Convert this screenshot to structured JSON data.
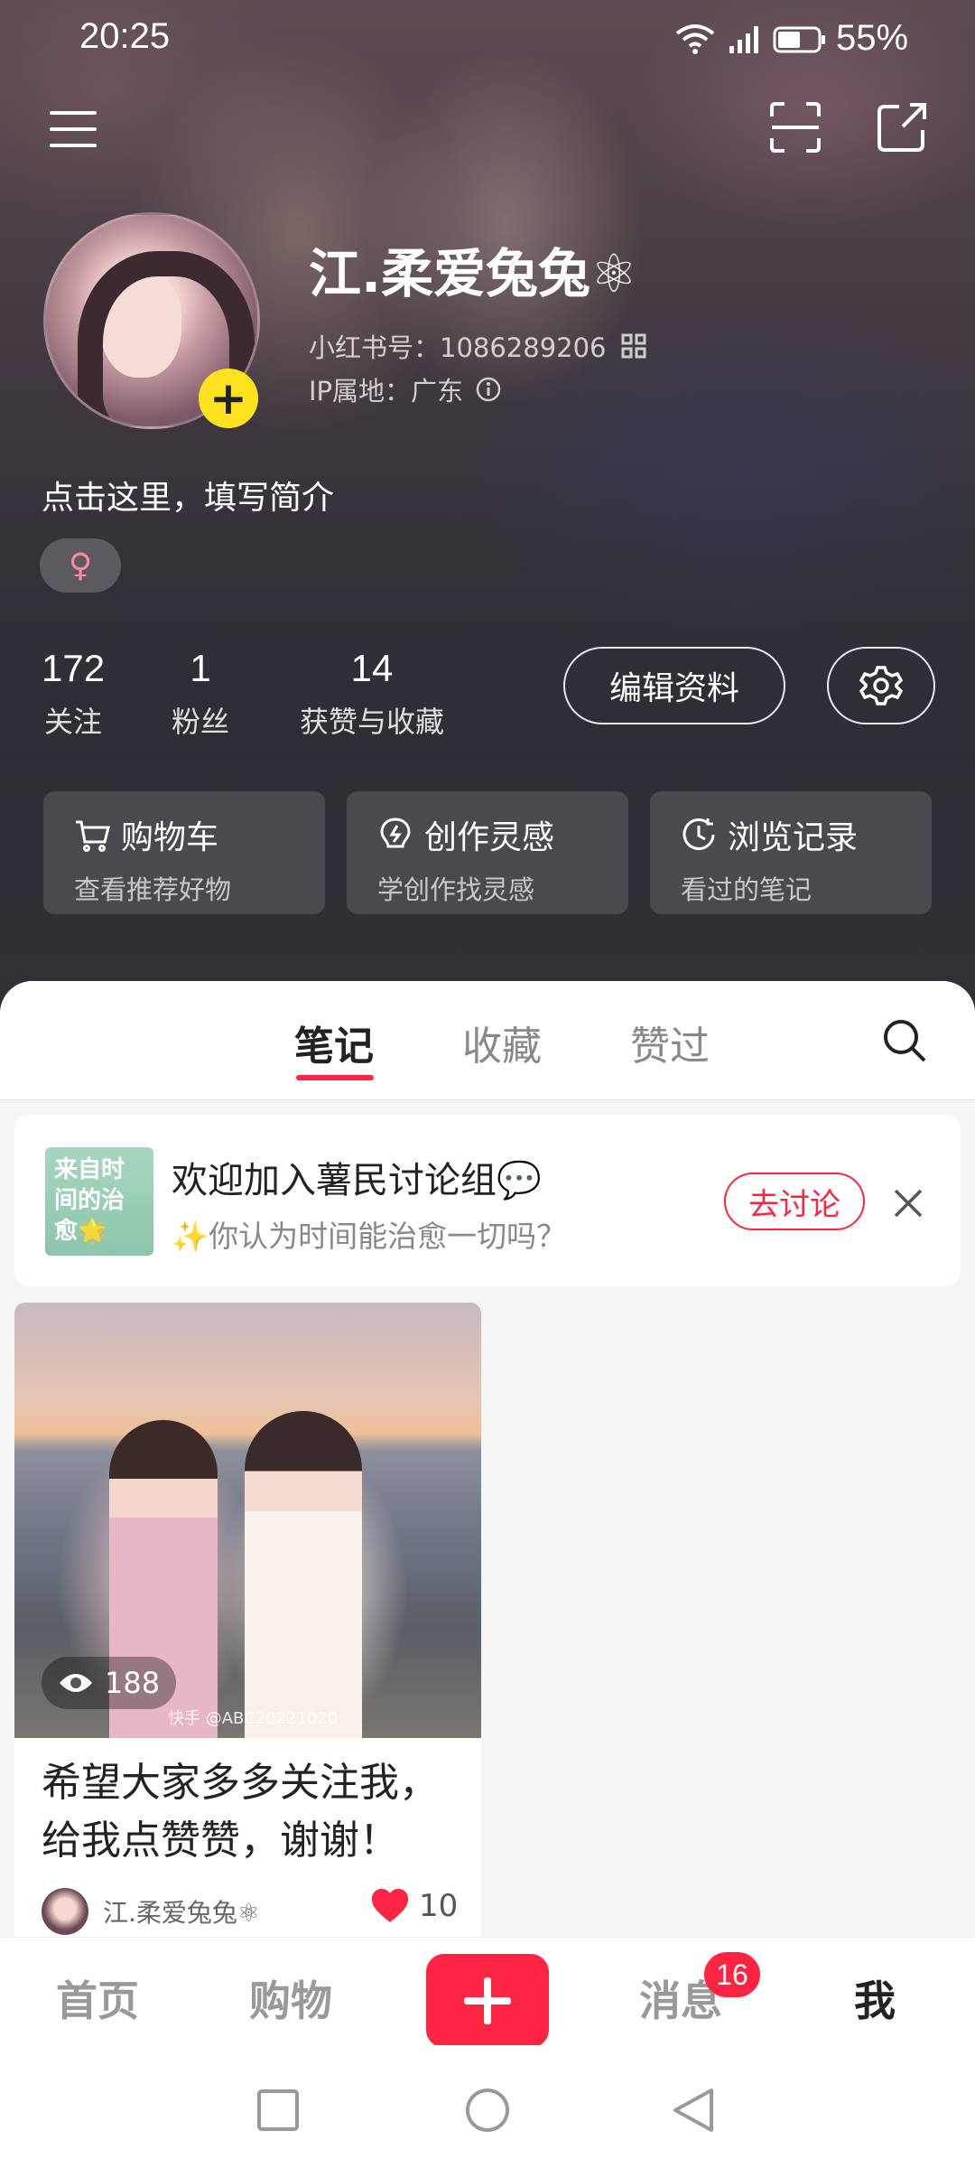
{
  "status_bar": {
    "time": "20:25",
    "battery": "55%",
    "network": "4G"
  },
  "profile": {
    "name": "江.柔爱兔兔⚛",
    "id_label": "小红书号：1086289206",
    "ip_label": "IP属地：广东",
    "bio_placeholder": "点击这里，填写简介",
    "gender_symbol": "♀",
    "stats": [
      {
        "value": "172",
        "label": "关注"
      },
      {
        "value": "1",
        "label": "粉丝"
      },
      {
        "value": "14",
        "label": "获赞与收藏"
      }
    ],
    "edit_button": "编辑资料"
  },
  "quick_links": [
    {
      "title": "购物车",
      "subtitle": "查看推荐好物",
      "icon": "cart-icon"
    },
    {
      "title": "创作灵感",
      "subtitle": "学创作找灵感",
      "icon": "bulb-icon"
    },
    {
      "title": "浏览记录",
      "subtitle": "看过的笔记",
      "icon": "clock-icon"
    }
  ],
  "tabs": [
    {
      "label": "笔记",
      "active": true
    },
    {
      "label": "收藏",
      "active": false
    },
    {
      "label": "赞过",
      "active": false
    }
  ],
  "banner": {
    "thumb_text": "来自时间的治愈🌟",
    "title": "欢迎加入薯民讨论组💬",
    "subtitle": "✨你认为时间能治愈一切吗？",
    "action": "去讨论"
  },
  "note_card": {
    "views": "188",
    "watermark": "快手 @ABC20221020",
    "title": "希望大家多多关注我，给我点赞赞，谢谢！",
    "author": "江.柔爱兔兔⚛",
    "likes": "10"
  },
  "bottom_nav": {
    "items": [
      "首页",
      "购物",
      "消息",
      "我"
    ],
    "message_badge": "16",
    "active": "我"
  },
  "colors": {
    "accent": "#ff2442",
    "badge_yellow": "#ffe21f"
  }
}
